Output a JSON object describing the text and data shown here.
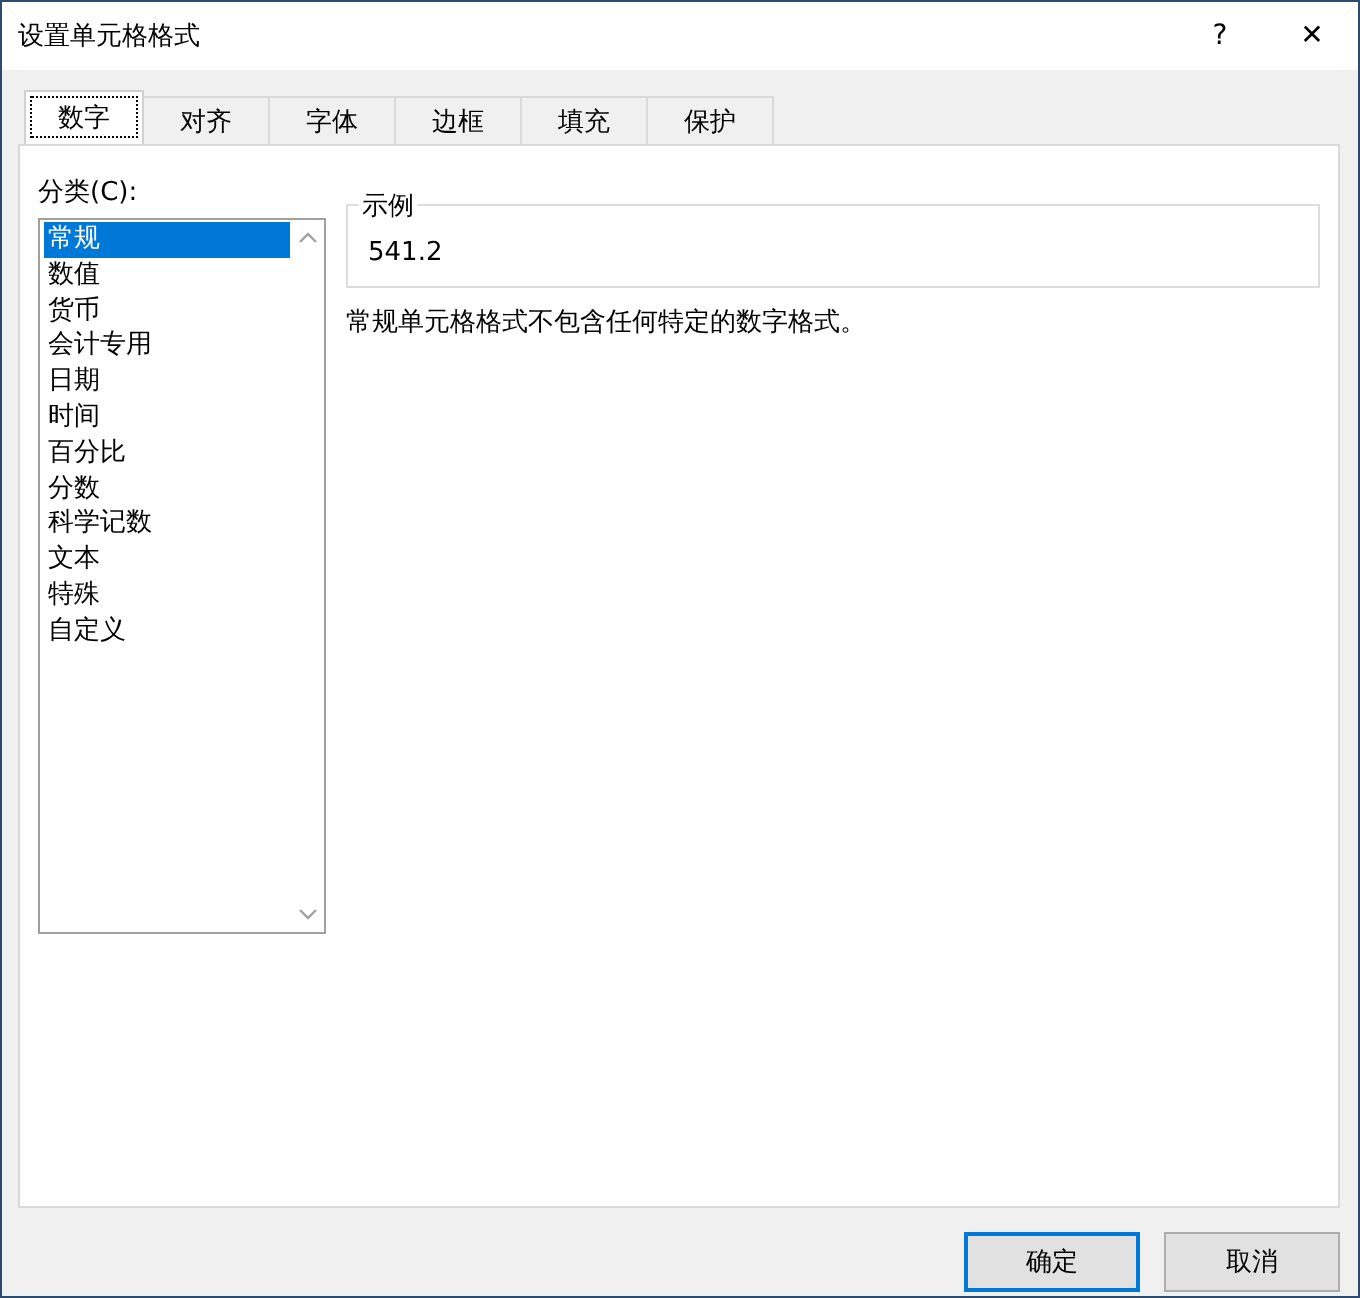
{
  "window": {
    "title": "设置单元格格式",
    "help": "?",
    "close": "✕"
  },
  "tabs": [
    {
      "label": "数字",
      "selected": true
    },
    {
      "label": "对齐",
      "selected": false
    },
    {
      "label": "字体",
      "selected": false
    },
    {
      "label": "边框",
      "selected": false
    },
    {
      "label": "填充",
      "selected": false
    },
    {
      "label": "保护",
      "selected": false
    }
  ],
  "category": {
    "label": "分类(C):",
    "items": [
      {
        "label": "常规",
        "selected": true
      },
      {
        "label": "数值",
        "selected": false
      },
      {
        "label": "货币",
        "selected": false
      },
      {
        "label": "会计专用",
        "selected": false
      },
      {
        "label": "日期",
        "selected": false
      },
      {
        "label": "时间",
        "selected": false
      },
      {
        "label": "百分比",
        "selected": false
      },
      {
        "label": "分数",
        "selected": false
      },
      {
        "label": "科学记数",
        "selected": false
      },
      {
        "label": "文本",
        "selected": false
      },
      {
        "label": "特殊",
        "selected": false
      },
      {
        "label": "自定义",
        "selected": false
      }
    ]
  },
  "sample": {
    "label": "示例",
    "value": "541.2"
  },
  "description": "常规单元格格式不包含任何特定的数字格式。",
  "buttons": [
    {
      "label": "确定",
      "default": true
    },
    {
      "label": "取消",
      "default": false
    }
  ]
}
